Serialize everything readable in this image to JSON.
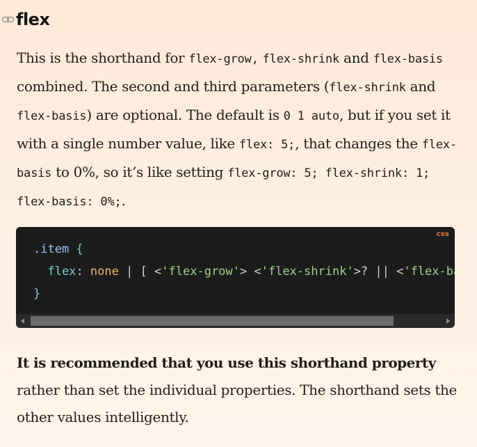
{
  "heading": {
    "title": "flex",
    "icon": "link-icon"
  },
  "paragraph1": {
    "t1": "This is the shorthand for ",
    "c1": "flex-grow,",
    "t2": " ",
    "c2": "flex-shrink",
    "t3": " and ",
    "c3": "flex-basis",
    "t4": " combined. The second and third parameters (",
    "c4": "flex-shrink",
    "t5": " and ",
    "c5": "flex-basis",
    "t6": ") are optional. The default is ",
    "c6": "0 1 auto",
    "t7": ", but if you set it with a single number value, like ",
    "c7": "flex: 5;",
    "t8": ", that changes the ",
    "c8": "flex-basis",
    "t9": " to 0%, so it’s like setting ",
    "c9": "flex-grow: 5; flex-shrink: 1; flex-basis: 0%;",
    "t10": "."
  },
  "code_block": {
    "language": "css",
    "line1_selector": ".item",
    "line1_brace": " {",
    "line2_indent": "  ",
    "line2_prop": "flex",
    "line2_colon": ": ",
    "line2_val": "none",
    "line2_op1": " | [ <",
    "line2_str1": "'flex-grow'",
    "line2_op2": "> <",
    "line2_str2": "'flex-shrink'",
    "line2_op3": ">? || <",
    "line2_str3": "'flex-basis'",
    "line2_op4": "> ]",
    "line3_brace": "}"
  },
  "paragraph2": {
    "bold": "It is recommended that you use this shorthand property",
    "rest": " rather than set the individual properties. The shorthand sets the other values intelligently."
  },
  "colors": {
    "code_bg": "#1c1c1c",
    "lang_badge": "#f27535",
    "page_bg": "#fde9d8"
  }
}
